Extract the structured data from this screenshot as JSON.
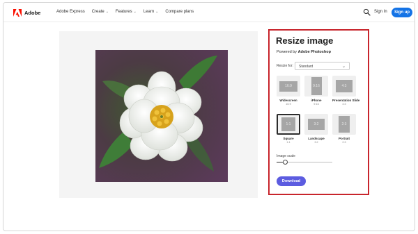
{
  "nav": {
    "brand": "Adobe",
    "links": [
      {
        "label": "Adobe Express",
        "chevron": false
      },
      {
        "label": "Create",
        "chevron": true
      },
      {
        "label": "Features",
        "chevron": true
      },
      {
        "label": "Learn",
        "chevron": true
      },
      {
        "label": "Compare plans",
        "chevron": false
      }
    ],
    "chevron_glyph": "⌄",
    "search_icon": "search-icon",
    "sign_in": "Sign In",
    "sign_up": "Sign up",
    "accent": "#1473e6",
    "brand_color": "#fa0f00"
  },
  "panel": {
    "title": "Resize image",
    "powered_prefix": "Powered by",
    "powered_brand": "Adobe Photoshop",
    "resize_label": "Resize for:",
    "resize_value": "Standard",
    "sizes": [
      {
        "name": "Widescreen",
        "ratio": "16:9",
        "inner": "16:9",
        "selected": false
      },
      {
        "name": "iPhone",
        "ratio": "9:16",
        "inner": "9:16",
        "selected": false
      },
      {
        "name": "Presentation Slide",
        "ratio": "4:3",
        "inner": "4:3",
        "selected": false
      },
      {
        "name": "Square",
        "ratio": "1:1",
        "inner": "1:1",
        "selected": true
      },
      {
        "name": "Landscape",
        "ratio": "3:2",
        "inner": "3:2",
        "selected": false
      },
      {
        "name": "Portrait",
        "ratio": "2:3",
        "inner": "2:3",
        "selected": false
      }
    ],
    "scale_label": "Image scale",
    "scale_value": 0.12,
    "download": "Download",
    "highlight_color": "#c8252c",
    "download_color": "#5c5ce0"
  }
}
